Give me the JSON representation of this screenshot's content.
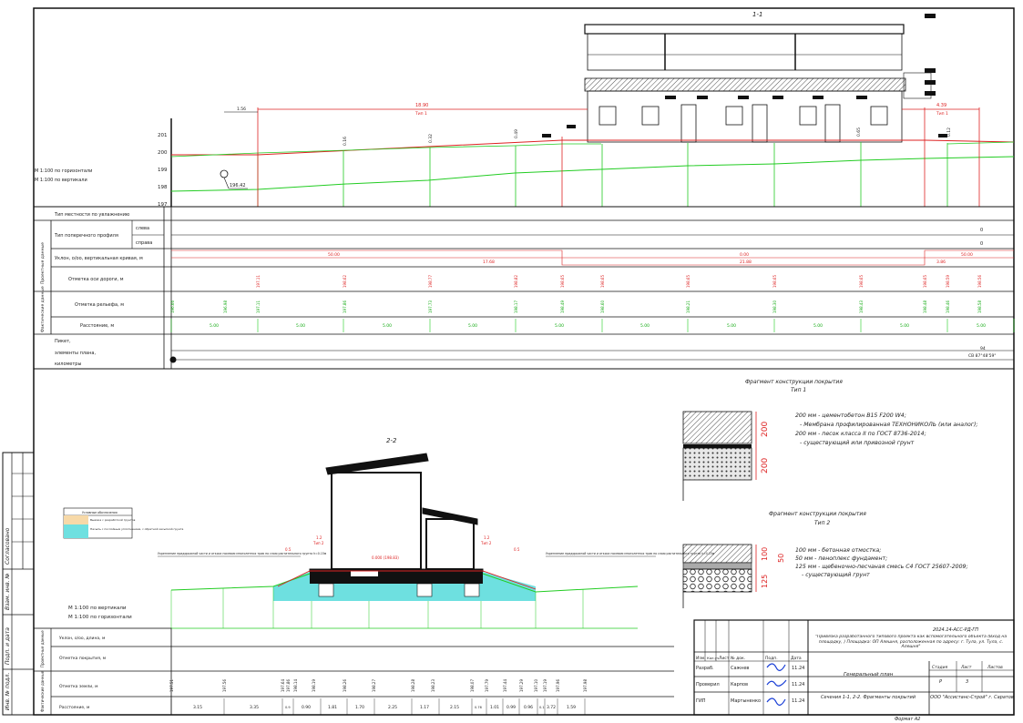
{
  "section_top": {
    "title": "1-1",
    "scale_lines": [
      "М 1:100 по горизонтали",
      "М 1:100 по вертикали"
    ],
    "elev_ticks": [
      "201",
      "200",
      "199",
      "198",
      "197"
    ],
    "slope_dims": [
      {
        "value": "18.90",
        "tip": "Тип 1"
      },
      {
        "value": "4.39",
        "tip": "Тип 1"
      }
    ],
    "small_dim": "1.56",
    "point_label": "196.42",
    "slope_values": [
      "0.16",
      "0.32",
      "0.49",
      "0.65",
      "0.12"
    ],
    "rows": {
      "terrain_type": "Тип местности по увлажнению",
      "cross_profile": "Тип поперечного профиля",
      "left": "слева",
      "right": "справа",
      "slope": "Уклон, о/оо, вертикальная кривая, м",
      "axis_mark": "Отметка оси дороги, м",
      "relief_mark": "Отметка рельефа, м",
      "distance": "Расстояние, м",
      "picket": "Пикет,",
      "plan_elements": "элементы плана,",
      "km": "километры"
    },
    "group_project": "Проектные данные",
    "group_actual": "Фактические данные",
    "slope_row": [
      {
        "top": "50.00",
        "bottom": "17.68"
      },
      {
        "top": "0.00",
        "bottom": "21.88"
      },
      {
        "top": "50.00",
        "bottom": "3.86"
      }
    ],
    "axis_marks": [
      "197.11",
      "198.62",
      "198.77",
      "198.82",
      "198.65",
      "198.65",
      "198.65",
      "198.65",
      "198.65",
      "198.65",
      "198.59",
      "198.56"
    ],
    "relief_marks": [
      "196.66",
      "196.98",
      "197.11",
      "197.86",
      "197.73",
      "198.17",
      "198.49",
      "198.60",
      "198.21",
      "198.30",
      "198.43",
      "198.48",
      "198.46",
      "198.58"
    ],
    "distances": [
      "5.00",
      "5.00",
      "5.00",
      "5.00",
      "5.00",
      "5.00",
      "5.00",
      "5.00",
      "5.00",
      "5.00"
    ],
    "zero_right": "0",
    "picket_value": "94",
    "picket_dir": "СВ 87°48'59\""
  },
  "section_2": {
    "title": "2-2",
    "legend_title": "Условные обозначения",
    "legend_items": [
      "Выемка с разработкой грунтов",
      "Насыпь с послойным уплотнением, с обратной засыпкой грунта"
    ],
    "note_left": "Укрепление придорожной части и откоса посевом многолетних трав по слою растительного грунта h=0.15м",
    "note_right": "Укрепление придорожной части и откоса посевом многолетних трав по слою растительного грунта h=0.15м",
    "dims": [
      "0.5",
      "1.2",
      "Тип 2",
      "1.2",
      "Тип 2",
      "0.5"
    ],
    "center_mark": "0.000 (198.83)",
    "scale_lines": [
      "М 1:100 по вертикали",
      "М 1:100 по горизонтали"
    ],
    "rows": {
      "slope": "Уклон, о/оо, длина, м",
      "cover_mark": "Отметка покрытия, м",
      "ground_mark": "Отметка земли, м",
      "distance": "Расстояние, м"
    },
    "ground_marks": [
      "197.51",
      "197.56",
      "197.64",
      "197.86",
      "198.14",
      "198.19",
      "198.26",
      "198.27",
      "198.28",
      "198.23",
      "198.07",
      "197.79",
      "197.44",
      "197.29",
      "197.10",
      "197.19",
      "197.96",
      "197.98"
    ],
    "distances": [
      "3.15",
      "3.35",
      "0.9",
      "0.90",
      "1.81",
      "1.70",
      "2.25",
      "1.17",
      "2.15",
      "0.76",
      "1.01",
      "0.99",
      "0.96",
      "0.1",
      "3.72",
      "1.59"
    ]
  },
  "fragment1": {
    "title": "Фрагмент конструкции покрытия",
    "tip": "Тип 1",
    "layers": [
      "200 мм - цементобетон B15 F200 W4;",
      "- Мембрана профилированная ТЕХНОНИКОЛЬ (или аналог);",
      "200 мм - песок класса II по ГОСТ 8736-2014;",
      "- существующий или привозной грунт"
    ],
    "dims": [
      "200",
      "200"
    ]
  },
  "fragment2": {
    "title": "Фрагмент конструкции покрытия",
    "tip": "Тип 2",
    "layers": [
      "100 мм - бетонная отмостка;",
      "50 мм - пеноплекс фундамент;",
      "125 мм - щебеночно-песчаная смесь С4 ГОСТ 25607-2009;",
      "- существующий грунт"
    ],
    "dims": [
      "100",
      "50",
      "125"
    ]
  },
  "stamp": {
    "code": "2024.14-АСС-РД-ГП",
    "project": "\"Привязка разработанного типового проекта как вспомогательного объекта (Вход на площадку, ) Площадка: ОП Алешня, расположенная по адресу: г. Тула, ул. Тула, с. Алешня\"",
    "headers": [
      "Изм.",
      "Кол.уч",
      "Лист",
      "№ док.",
      "Подп.",
      "Дата"
    ],
    "people": [
      {
        "role": "Разраб.",
        "name": "Сажнев",
        "date": "11.24"
      },
      {
        "role": "Проверил",
        "name": "Карпов",
        "date": "11.24"
      },
      {
        "role": "ГИП",
        "name": "Мартыненко",
        "date": "11.24"
      }
    ],
    "plan_title": "Генеральный план",
    "stage_h": "Стадия",
    "sheet_h": "Лист",
    "sheets_h": "Листов",
    "stage": "Р",
    "sheet": "3",
    "sheet_title": "Сечения 1-1, 2-2. Фрагменты покрытий",
    "org": "ООО \"Ассистанс-Строй\" г. Саратов",
    "format": "Формат А2"
  },
  "side_stamp": [
    "Инв. № подл.",
    "Подп. и дата",
    "Взам. инв. №",
    "Согласовано"
  ]
}
